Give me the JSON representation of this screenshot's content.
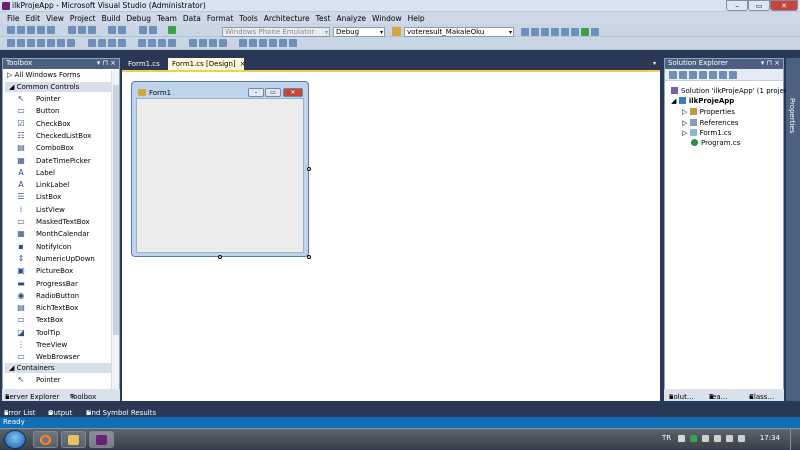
{
  "window": {
    "title": "ilkProjeApp - Microsoft Visual Studio (Administrator)"
  },
  "menu": [
    "File",
    "Edit",
    "View",
    "Project",
    "Build",
    "Debug",
    "Team",
    "Data",
    "Format",
    "Tools",
    "Architecture",
    "Test",
    "Analyze",
    "Window",
    "Help"
  ],
  "toolbar": {
    "emulator": "Windows Phone Emulator",
    "config": "Debug",
    "find": "voteresult_MakaleOku"
  },
  "toolbox": {
    "title": "Toolbox",
    "pin": "▾ ⊓ ×",
    "all_forms": "All Windows Forms",
    "common_header": "Common Controls",
    "items": [
      {
        "label": "Pointer",
        "glyph": "↖"
      },
      {
        "label": "Button",
        "glyph": "▭"
      },
      {
        "label": "CheckBox",
        "glyph": "☑"
      },
      {
        "label": "CheckedListBox",
        "glyph": "☷"
      },
      {
        "label": "ComboBox",
        "glyph": "▤"
      },
      {
        "label": "DateTimePicker",
        "glyph": "▦"
      },
      {
        "label": "Label",
        "glyph": "A"
      },
      {
        "label": "LinkLabel",
        "glyph": "A"
      },
      {
        "label": "ListBox",
        "glyph": "☰"
      },
      {
        "label": "ListView",
        "glyph": "⁞"
      },
      {
        "label": "MaskedTextBox",
        "glyph": "▭"
      },
      {
        "label": "MonthCalendar",
        "glyph": "▦"
      },
      {
        "label": "NotifyIcon",
        "glyph": "▪"
      },
      {
        "label": "NumericUpDown",
        "glyph": "⇕"
      },
      {
        "label": "PictureBox",
        "glyph": "▣"
      },
      {
        "label": "ProgressBar",
        "glyph": "▬"
      },
      {
        "label": "RadioButton",
        "glyph": "◉"
      },
      {
        "label": "RichTextBox",
        "glyph": "▤"
      },
      {
        "label": "TextBox",
        "glyph": "▭"
      },
      {
        "label": "ToolTip",
        "glyph": "◪"
      },
      {
        "label": "TreeView",
        "glyph": "⋮"
      },
      {
        "label": "WebBrowser",
        "glyph": "▭"
      }
    ],
    "containers_header": "Containers",
    "containers_items": [
      {
        "label": "Pointer",
        "glyph": "↖"
      }
    ],
    "tabs": {
      "server": "Server Explorer",
      "toolbox": "Toolbox"
    }
  },
  "doc_tabs": [
    {
      "label": "Form1.cs"
    },
    {
      "label": "Form1.cs [Design]"
    }
  ],
  "doc_tab_close": "×",
  "designer": {
    "form_title": "Form1"
  },
  "solution_explorer": {
    "title": "Solution Explorer",
    "pin": "▾ ⊓ ×",
    "solution": "Solution 'ilkProjeApp' (1 project)",
    "project": "ilkProjeApp",
    "children": [
      "Properties",
      "References",
      "Form1.cs",
      "Program.cs"
    ],
    "tabs": {
      "solution": "Solut...",
      "team": "Tea...",
      "class": "Class..."
    }
  },
  "properties_tab": "Properties",
  "bottom_tabs": {
    "errors": "Error List",
    "output": "Output",
    "find": "Find Symbol Results"
  },
  "status": {
    "text": "Ready"
  },
  "taskbar": {
    "lang": "TR",
    "clock": "17:34"
  },
  "colors": {
    "accent_tab": "#fff9d9",
    "doc_border": "#f5cd4b",
    "status": "#0e6fb7"
  }
}
